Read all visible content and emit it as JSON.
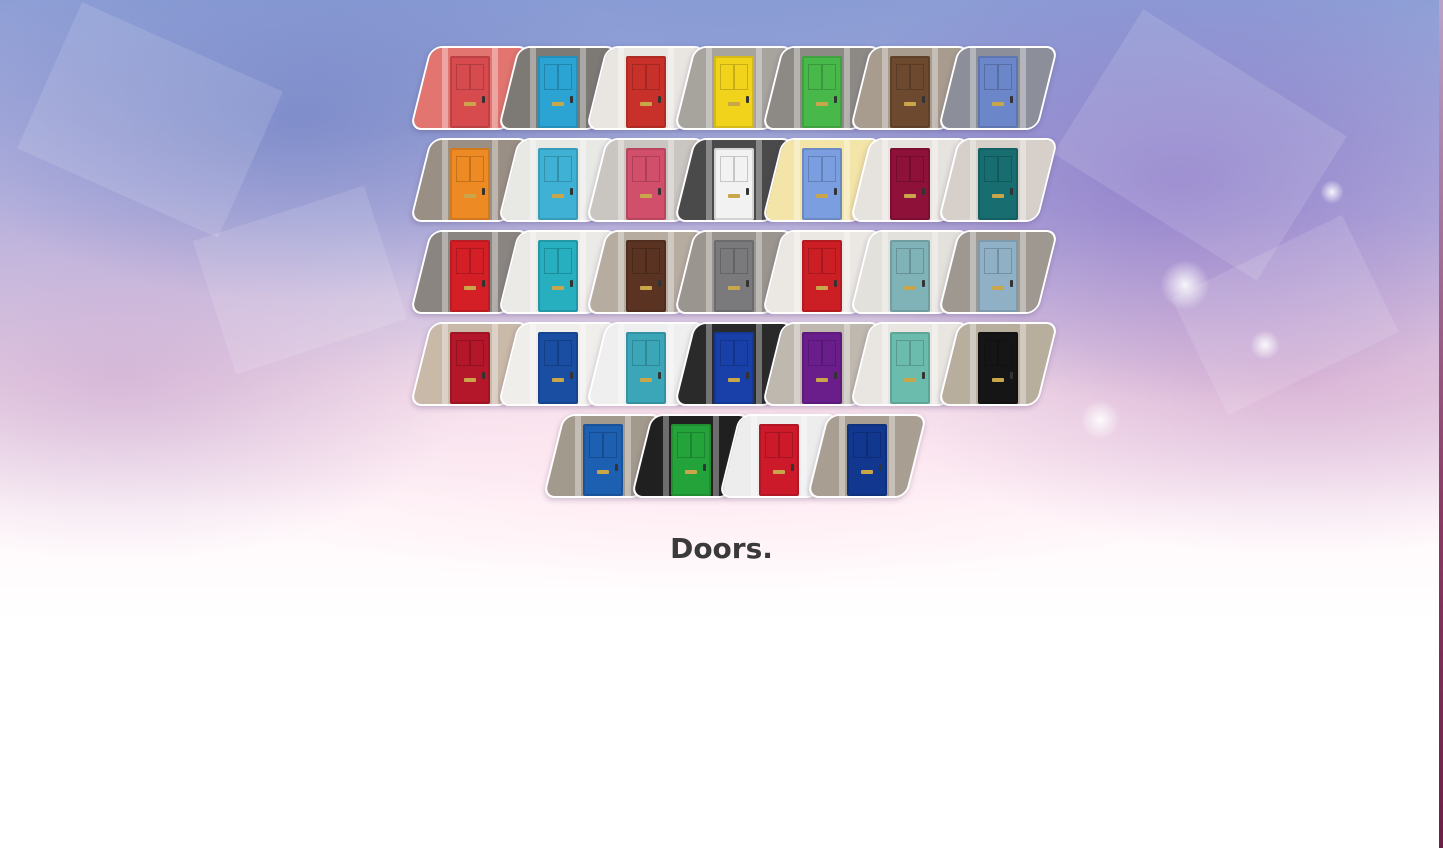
{
  "caption": "Doors.",
  "door_tiles": [
    {
      "row": 0,
      "door": "#d74b4e",
      "wall": "#e2756f"
    },
    {
      "row": 0,
      "door": "#2ba3d3",
      "wall": "#7d7a75"
    },
    {
      "row": 0,
      "door": "#c8312a",
      "wall": "#e9e6e2"
    },
    {
      "row": 0,
      "door": "#f2d31c",
      "wall": "#a7a39d"
    },
    {
      "row": 0,
      "door": "#49b84a",
      "wall": "#8d8a86"
    },
    {
      "row": 0,
      "door": "#6d4a2f",
      "wall": "#a89c8f"
    },
    {
      "row": 0,
      "door": "#6b86c9",
      "wall": "#8c8f99"
    },
    {
      "row": 1,
      "door": "#ee8a24",
      "wall": "#9a8f84"
    },
    {
      "row": 1,
      "door": "#3fb1d4",
      "wall": "#e8e8e5"
    },
    {
      "row": 1,
      "door": "#d24f6c",
      "wall": "#c9c5c0"
    },
    {
      "row": 1,
      "door": "#f2f2f2",
      "wall": "#4a4a4a"
    },
    {
      "row": 1,
      "door": "#7a9ee0",
      "wall": "#f3e4a8"
    },
    {
      "row": 1,
      "door": "#8d1138",
      "wall": "#e6e2de"
    },
    {
      "row": 1,
      "door": "#176d6f",
      "wall": "#d6cfca"
    },
    {
      "row": 2,
      "door": "#d51f27",
      "wall": "#8a8580"
    },
    {
      "row": 2,
      "door": "#27aebf",
      "wall": "#eceae6"
    },
    {
      "row": 2,
      "door": "#5a3323",
      "wall": "#b6aca0"
    },
    {
      "row": 2,
      "door": "#7a7a7d",
      "wall": "#9a958f"
    },
    {
      "row": 2,
      "door": "#cc1f25",
      "wall": "#ebe7e3"
    },
    {
      "row": 2,
      "door": "#7fb3b7",
      "wall": "#e3e1dc"
    },
    {
      "row": 2,
      "door": "#8fb0c5",
      "wall": "#9e9891"
    },
    {
      "row": 3,
      "door": "#b4172a",
      "wall": "#c9b9a8"
    },
    {
      "row": 3,
      "door": "#1a4ea3",
      "wall": "#f0eeeb"
    },
    {
      "row": 3,
      "door": "#3ba6b8",
      "wall": "#efefef"
    },
    {
      "row": 3,
      "door": "#1840a8",
      "wall": "#2a2a2a"
    },
    {
      "row": 3,
      "door": "#6a1e8c",
      "wall": "#bfb8ae"
    },
    {
      "row": 3,
      "door": "#6cbcae",
      "wall": "#e9e6e1"
    },
    {
      "row": 3,
      "door": "#151515",
      "wall": "#b8ae9e"
    },
    {
      "row": 4,
      "door": "#1d5fb0",
      "wall": "#a39a8e"
    },
    {
      "row": 4,
      "door": "#24a33a",
      "wall": "#202020"
    },
    {
      "row": 4,
      "door": "#cc1a2a",
      "wall": "#ededed"
    },
    {
      "row": 4,
      "door": "#11378f",
      "wall": "#a89f92"
    }
  ]
}
